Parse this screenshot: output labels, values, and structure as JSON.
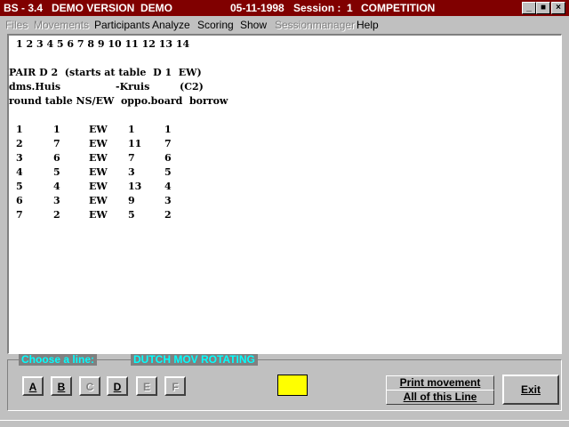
{
  "title_bar": {
    "app": "BS - 3.4",
    "version": "DEMO VERSION  DEMO",
    "date": "05-11-1998",
    "session": "Session :  1",
    "mode": "COMPETITION",
    "minimize_label": "_",
    "maximize_label": "■",
    "close_label": "×"
  },
  "menu": {
    "files": "Files",
    "movements": "Movements",
    "participants": "Participants",
    "analyze": "Analyze",
    "scoring": "Scoring",
    "show": "Show",
    "sessionmanager": "Sessionmanager",
    "help": "Help"
  },
  "report": {
    "rounds_line": "1 2 3 4 5 6 7 8 9 10 11 12 13 14",
    "pair_line": "PAIR D 2  (starts at table  D 1  EW)",
    "player1": "dms.Huis",
    "player2": "-Kruis",
    "player_class": "(C2)",
    "headers": "round table NS/EW  oppo.board  borrow",
    "rows": [
      {
        "round": "1",
        "table": "1",
        "side": "EW",
        "oppo": "1",
        "board": "1"
      },
      {
        "round": "2",
        "table": "7",
        "side": "EW",
        "oppo": "11",
        "board": "7"
      },
      {
        "round": "3",
        "table": "6",
        "side": "EW",
        "oppo": "7",
        "board": "6"
      },
      {
        "round": "4",
        "table": "5",
        "side": "EW",
        "oppo": "3",
        "board": "5"
      },
      {
        "round": "5",
        "table": "4",
        "side": "EW",
        "oppo": "13",
        "board": "4"
      },
      {
        "round": "6",
        "table": "3",
        "side": "EW",
        "oppo": "9",
        "board": "3"
      },
      {
        "round": "7",
        "table": "2",
        "side": "EW",
        "oppo": "5",
        "board": "2"
      }
    ]
  },
  "panel": {
    "choose_label": "Choose a line:",
    "movement_name": "DUTCH MOV ROTATING",
    "line_buttons": [
      "A",
      "B",
      "C",
      "D",
      "E",
      "F"
    ],
    "print_movement": "Print movement",
    "all_of_line": "All of this Line",
    "exit": "Exit"
  },
  "colors": {
    "title_bg": "#800000",
    "panel_label": "#00ffff",
    "indicator": "#ffff00"
  }
}
